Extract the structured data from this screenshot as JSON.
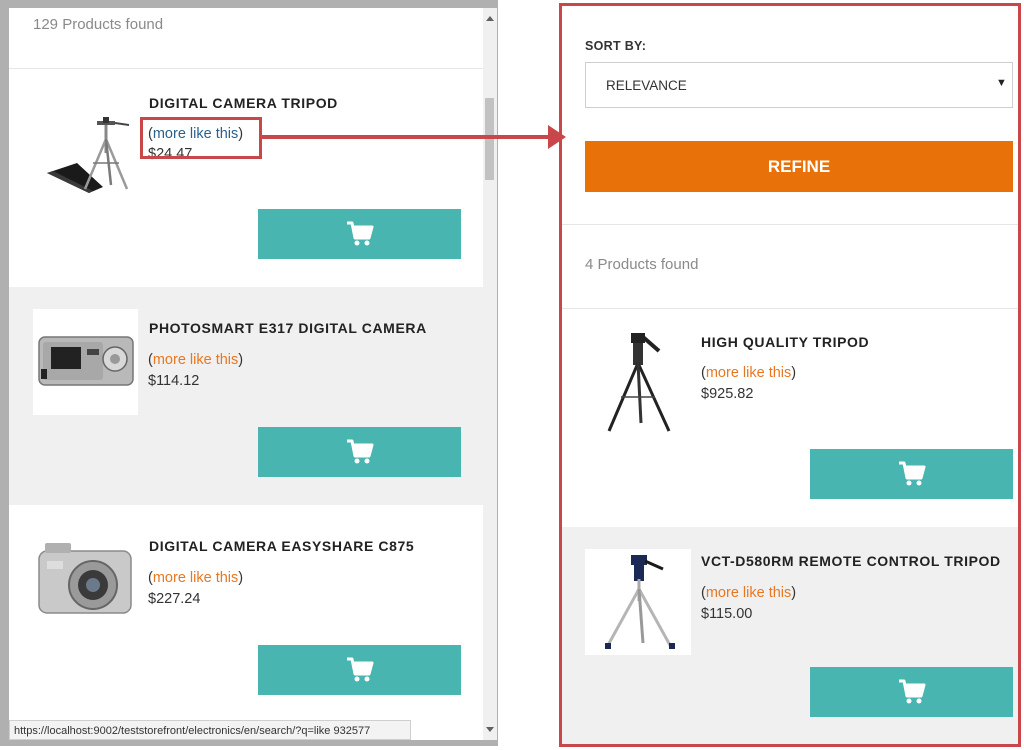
{
  "left_panel": {
    "count_text": "129 Products found",
    "products": [
      {
        "title": "DIGITAL CAMERA TRIPOD",
        "more_open": "(",
        "more_link": "more like this",
        "more_close": ")",
        "price": "$24.47",
        "image_icon": "tripod-thumbnail"
      },
      {
        "title": "PHOTOSMART E317 DIGITAL CAMERA",
        "more_open": "(",
        "more_link": "more like this",
        "more_close": ")",
        "price": "$114.12",
        "image_icon": "compact-camera-thumbnail"
      },
      {
        "title": "DIGITAL CAMERA EASYSHARE C875",
        "more_open": "(",
        "more_link": "more like this",
        "more_close": ")",
        "price": "$227.24",
        "image_icon": "silver-camera-thumbnail"
      }
    ],
    "cart_icon": "shopping-cart-icon",
    "status_url": "https://localhost:9002/teststorefront/electronics/en/search/?q=like 932577"
  },
  "right_panel": {
    "sort_label": "SORT BY:",
    "sort_value": "RELEVANCE",
    "refine_label": "REFINE",
    "count_text": "4 Products found",
    "products": [
      {
        "title": "HIGH QUALITY TRIPOD",
        "more_open": "(",
        "more_link": "more like this",
        "more_close": ")",
        "price": "$925.82",
        "image_icon": "video-tripod-thumbnail"
      },
      {
        "title": "VCT-D580RM REMOTE CONTROL TRIPOD",
        "more_open": "(",
        "more_link": "more like this",
        "more_close": ")",
        "price": "$115.00",
        "image_icon": "remote-tripod-thumbnail"
      }
    ]
  },
  "colors": {
    "accent_orange": "#e8710a",
    "cart_teal": "#48b5b0",
    "annotation_red": "#c9474a",
    "link_orange": "#e87722",
    "link_visited": "#2b5f8c"
  }
}
